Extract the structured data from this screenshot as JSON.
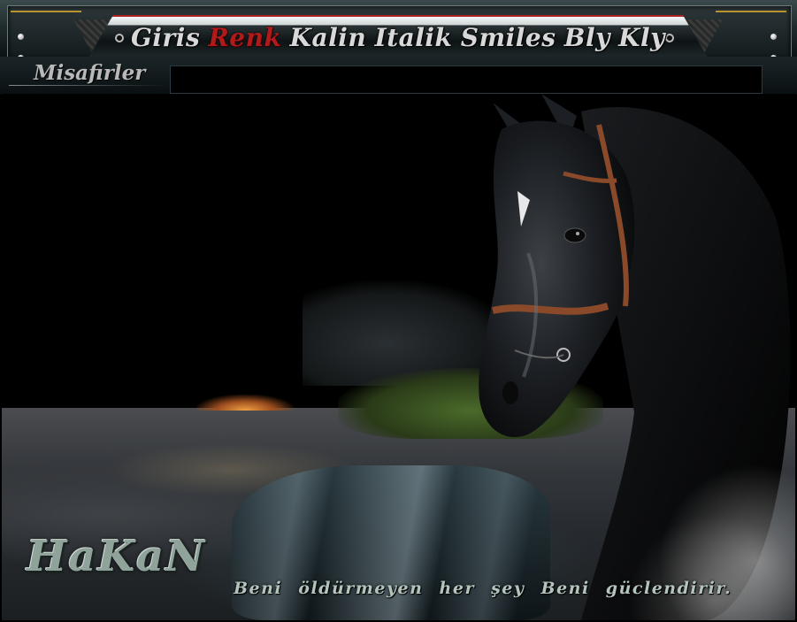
{
  "menu": {
    "items": [
      {
        "label": "Giris"
      },
      {
        "label": "Renk"
      },
      {
        "label": "Kalin"
      },
      {
        "label": "Italik"
      },
      {
        "label": "Smiles"
      },
      {
        "label": "Bly"
      },
      {
        "label": "Kly"
      }
    ]
  },
  "guests": {
    "label": "Misafirler"
  },
  "banner": {
    "name": "HaKaN",
    "tagline": "Beni öldürmeyen her şey Beni güclendirir."
  },
  "colors": {
    "accent_red": "#b11a1a",
    "gold": "#b8932e",
    "chrome_dark": "#0e1416",
    "text_silver": "#d8d8d8",
    "signature_green": "#8fa39b"
  },
  "icons": {
    "screw": "screw-icon",
    "menu_dot": "circle-dot-icon"
  }
}
